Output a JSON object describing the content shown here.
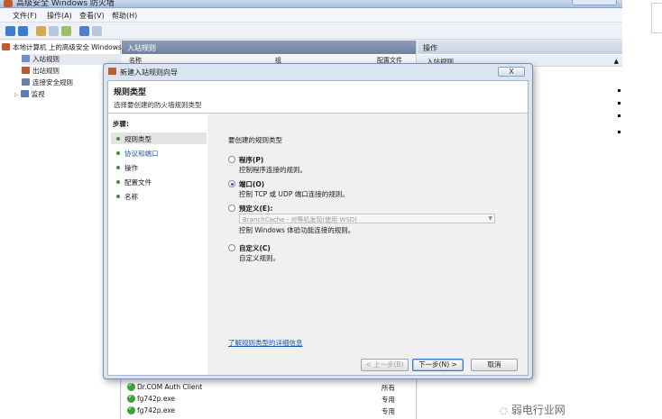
{
  "window": {
    "title": "高级安全 Windows 防火墙",
    "menu": [
      "文件(F)",
      "操作(A)",
      "查看(V)",
      "帮助(H)"
    ]
  },
  "tree": [
    "本地计算机 上的高级安全 Windows",
    "入站规则",
    "出站规则",
    "连接安全规则",
    "监视"
  ],
  "center": {
    "header": "入站规则",
    "columns": [
      "名称",
      "组",
      "配置文件"
    ],
    "rows": [
      {
        "name": "Dr.COM Auth Client",
        "profile": "所有"
      },
      {
        "name": "fg742p.exe",
        "profile": "专用"
      },
      {
        "name": "fg742p.exe",
        "profile": "专用"
      }
    ]
  },
  "actions": {
    "header": "操作",
    "sub": "入站规则"
  },
  "dialog": {
    "title": "新建入站规则向导",
    "close": "X",
    "heading": "规则类型",
    "subheading": "选择要创建的防火墙规则类型",
    "steps_label": "步骤:",
    "steps": [
      "规则类型",
      "协议和端口",
      "操作",
      "配置文件",
      "名称"
    ],
    "question": "要创建的规则类型",
    "options": [
      {
        "title": "程序(P)",
        "desc": "控制程序连接的规则。"
      },
      {
        "title": "端口(O)",
        "desc": "控制 TCP 或 UDP 端口连接的规则。"
      },
      {
        "title": "预定义(E):",
        "desc": "控制 Windows 体验功能连接的规则。"
      },
      {
        "title": "自定义(C)",
        "desc": "自定义规则。"
      }
    ],
    "selected_option": "端口(O)",
    "predefined_value": "BranchCache - 对等机发现(使用 WSD)",
    "learn_more": "了解规则类型的详细信息",
    "buttons": {
      "back": "< 上一步(B)",
      "next": "下一步(N) >",
      "cancel": "取消"
    }
  },
  "watermark": "弱电行业网",
  "colors": {
    "accent": "#1b55b3",
    "check": "#3aa43a",
    "dialog_frame": "#dbe5f2"
  }
}
